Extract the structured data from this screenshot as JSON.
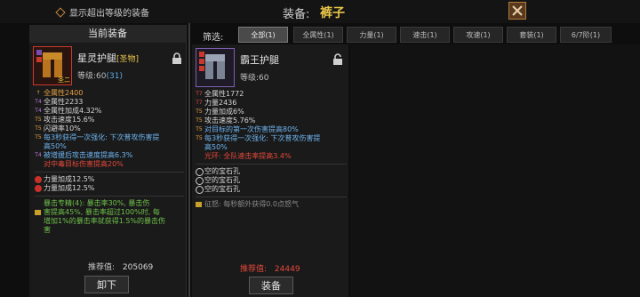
{
  "top": {
    "show_option": "显示超出等级的装备",
    "title_label": "装备:",
    "title_value": "裤子"
  },
  "current": {
    "panel_title": "当前装备",
    "item_name": "星灵护腿",
    "item_tag": "[圣物]",
    "level_prefix": "等级:60",
    "level_cur": "(31)",
    "icon_badge": "圣二",
    "stats": [
      {
        "badge": "↑",
        "text": "全属性2400",
        "color": "c-orange"
      },
      {
        "badge": "T4",
        "text": "全属性2233",
        "color": "c-white"
      },
      {
        "badge": "T4",
        "text": "全属性加成4.32%",
        "color": "c-white"
      },
      {
        "badge": "T5",
        "text": "攻击速度15.6%",
        "color": "c-white"
      },
      {
        "badge": "T5",
        "text": "闪避率10%",
        "color": "c-white"
      },
      {
        "badge": "T5",
        "text": "每3秒获得一次强化: 下次普攻伤害提",
        "color": "c-blue"
      },
      {
        "badge": "",
        "text": "高50%",
        "color": "c-blue"
      },
      {
        "badge": "T4",
        "text": "被增援后攻击速度提高6.3%",
        "color": "c-blue"
      },
      {
        "badge": "",
        "text": "对中毒目标伤害提高20%",
        "color": "c-red"
      }
    ],
    "gems": [
      {
        "text": "力量加成12.5%"
      },
      {
        "text": "力量加成12.5%"
      }
    ],
    "set_lines": [
      "暴击专精(4): 暴击率30%, 暴击伤",
      "害提高45%, 暴击率超过100%时, 每",
      "增加1%的暴击率就获得1.5%的暴击伤",
      "害"
    ],
    "rec_label": "推荐值:",
    "rec_value": "205069",
    "button": "卸下"
  },
  "filter": {
    "label": "筛选:",
    "tabs": [
      "全部(1)",
      "全属性(1)",
      "力量(1)",
      "速击(1)",
      "攻速(1)",
      "套装(1)",
      "6/7阶(1)"
    ]
  },
  "candidate": {
    "item_name": "霸王护腿",
    "level": "等级:60",
    "stats": [
      {
        "badge": "T7",
        "text": "全属性1772",
        "color": "c-white"
      },
      {
        "badge": "T7",
        "text": "力量2436",
        "color": "c-white"
      },
      {
        "badge": "T5",
        "text": "力量加成6%",
        "color": "c-white"
      },
      {
        "badge": "T5",
        "text": "攻击速度5.76%",
        "color": "c-white"
      },
      {
        "badge": "T5",
        "text": "对目标的第一次伤害提高80%",
        "color": "c-blue"
      },
      {
        "badge": "T5",
        "text": "每3秒获得一次强化: 下次普攻伤害提",
        "color": "c-blue"
      },
      {
        "badge": "",
        "text": "高50%",
        "color": "c-blue"
      },
      {
        "badge": "",
        "text": "光环: 全队速击率提高3.4%",
        "color": "c-red"
      }
    ],
    "sockets": [
      "空的宝石孔",
      "空的宝石孔",
      "空的宝石孔"
    ],
    "set_line": "征怒: 每秒额外获得0.0点怒气",
    "rec_label": "推荐值:",
    "rec_value": "24449",
    "button": "装备"
  }
}
